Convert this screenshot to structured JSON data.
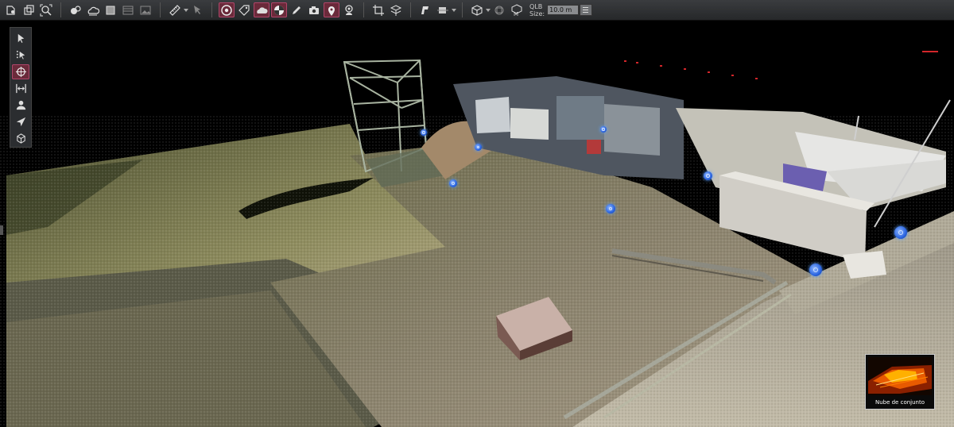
{
  "toolbar": {
    "groups": [
      {
        "name": "file",
        "icons": [
          "open-project-icon",
          "copy-icon",
          "zoom-fit-icon"
        ]
      },
      {
        "name": "display",
        "icons": [
          "spheres-icon",
          "cloud-icon",
          "square-icon",
          "layers-icon",
          "image-icon"
        ]
      },
      {
        "name": "measure",
        "icons": [
          "ruler-icon",
          "pointer-icon"
        ]
      },
      {
        "name": "annotate",
        "icons": [
          "target-icon",
          "tag-icon",
          "cloud-outline-icon",
          "checker-icon",
          "pencil-icon",
          "camera-icon",
          "location-pin-icon",
          "person-icon"
        ]
      },
      {
        "name": "geometry",
        "icons": [
          "crop-icon",
          "section-icon"
        ]
      },
      {
        "name": "view",
        "icons": [
          "perspective-icon",
          "clip-box-icon"
        ]
      },
      {
        "name": "cube",
        "icons": [
          "cube-icon",
          "shape-icon",
          "qlb-icon"
        ]
      }
    ],
    "qlb_label": "QLB",
    "size_label": "Size:",
    "size_value": "10.0 m"
  },
  "left_toolbar": {
    "tools": [
      "select-arrow-icon",
      "select-points-icon",
      "orbit-icon",
      "measure-distance-icon",
      "walk-icon",
      "fly-icon",
      "box-icon"
    ]
  },
  "overview": {
    "label": "Nube de conjunto"
  },
  "colors": {
    "toolbar_bg": "#2e3033",
    "active_accent": "#b0466a",
    "marker_blue": "#2a64e0"
  }
}
